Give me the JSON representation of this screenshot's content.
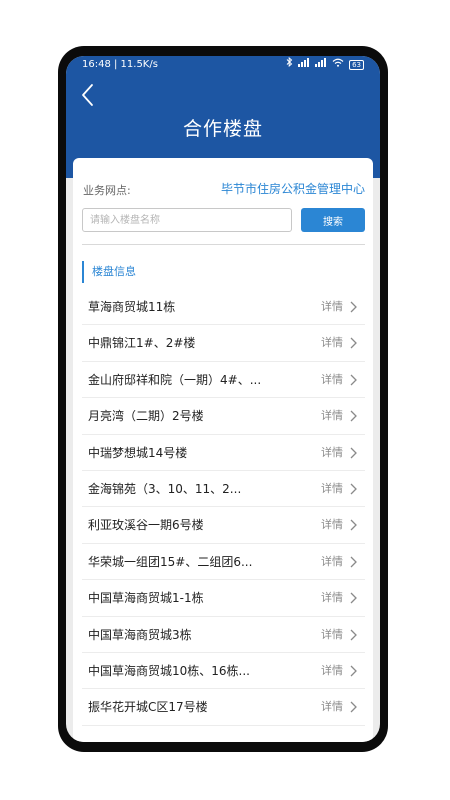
{
  "status_bar": {
    "time": "16:48 | 11.5K/s",
    "battery": "63"
  },
  "header": {
    "title": "合作楼盘"
  },
  "outlet": {
    "label": "业务网点:",
    "value": "毕节市住房公积金管理中心"
  },
  "search": {
    "placeholder": "请输入楼盘名称",
    "button_label": "搜索"
  },
  "section": {
    "title": "楼盘信息"
  },
  "detail_label": "详情",
  "items": [
    {
      "name": "草海商贸城11栋"
    },
    {
      "name": "中鼎锦江1#、2#楼"
    },
    {
      "name": "金山府邸祥和院（一期）4#、..."
    },
    {
      "name": "月亮湾（二期）2号楼"
    },
    {
      "name": "中瑞梦想城14号楼"
    },
    {
      "name": "金海锦苑（3、10、11、2..."
    },
    {
      "name": "利亚玫溪谷一期6号楼"
    },
    {
      "name": "华荣城一组团15#、二组团6..."
    },
    {
      "name": "中国草海商贸城1-1栋"
    },
    {
      "name": "中国草海商贸城3栋"
    },
    {
      "name": "中国草海商贸城10栋、16栋..."
    },
    {
      "name": "振华花开城C区17号楼"
    }
  ]
}
